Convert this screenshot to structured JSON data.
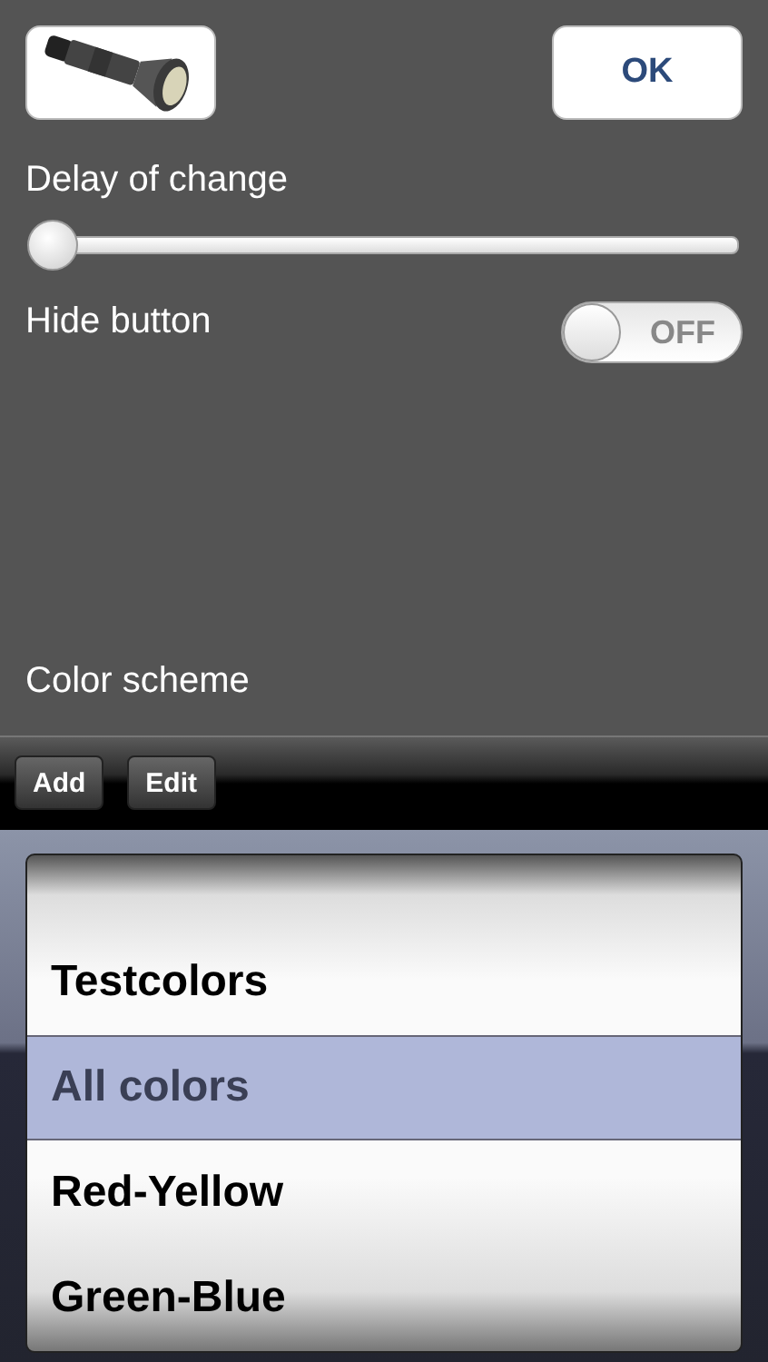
{
  "ok_button": {
    "label": "OK"
  },
  "delay": {
    "label": "Delay of change",
    "level": 0
  },
  "hide_button": {
    "label": "Hide button",
    "on": false,
    "off_label": "OFF"
  },
  "color_scheme": {
    "label": "Color scheme"
  },
  "toolbar": {
    "buttons": [
      "Add",
      "Edit"
    ]
  },
  "picker": {
    "items": [
      {
        "label": "Testcolors",
        "selected": false
      },
      {
        "label": "All colors",
        "selected": true
      },
      {
        "label": "Red-Yellow",
        "selected": false
      },
      {
        "label": "Green-Blue",
        "selected": false
      }
    ]
  }
}
